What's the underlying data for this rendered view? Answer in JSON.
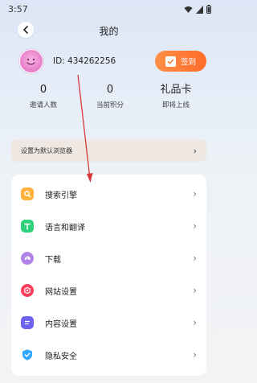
{
  "status_bar": {
    "time": "3:57",
    "icons": [
      "wifi-icon",
      "signal-icon",
      "battery-icon"
    ]
  },
  "header": {
    "title": "我的",
    "back_icon": "chevron-left-icon"
  },
  "profile": {
    "user_id": "ID: 434262256",
    "checkin_label": "签到",
    "checkin_icon": "calendar-check-icon"
  },
  "stats": [
    {
      "value": "0",
      "label": "邀请人数"
    },
    {
      "value": "0",
      "label": "当前积分"
    },
    {
      "value": "礼品卡",
      "label": "即将上线"
    }
  ],
  "default_browser": {
    "label": "设置为默认浏览器",
    "chevron": "›"
  },
  "menu": [
    {
      "label": "搜索引擎",
      "icon": "search-engine-icon",
      "color": "#ffb23c"
    },
    {
      "label": "语言和翻译",
      "icon": "translate-icon",
      "color": "#2fd17a"
    },
    {
      "label": "下载",
      "icon": "download-icon",
      "color": "#b184e8"
    },
    {
      "label": "网站设置",
      "icon": "website-settings-icon",
      "color": "#ff3d5d"
    },
    {
      "label": "内容设置",
      "icon": "content-settings-icon",
      "color": "#6e62f0"
    },
    {
      "label": "隐私安全",
      "icon": "privacy-shield-icon",
      "color": "#2fa6ff"
    }
  ],
  "menu_chevron": "›",
  "colors": {
    "accent_orange": "#ff7a35",
    "annotation_red": "#d83a3a",
    "card_background": "#ffffff"
  }
}
